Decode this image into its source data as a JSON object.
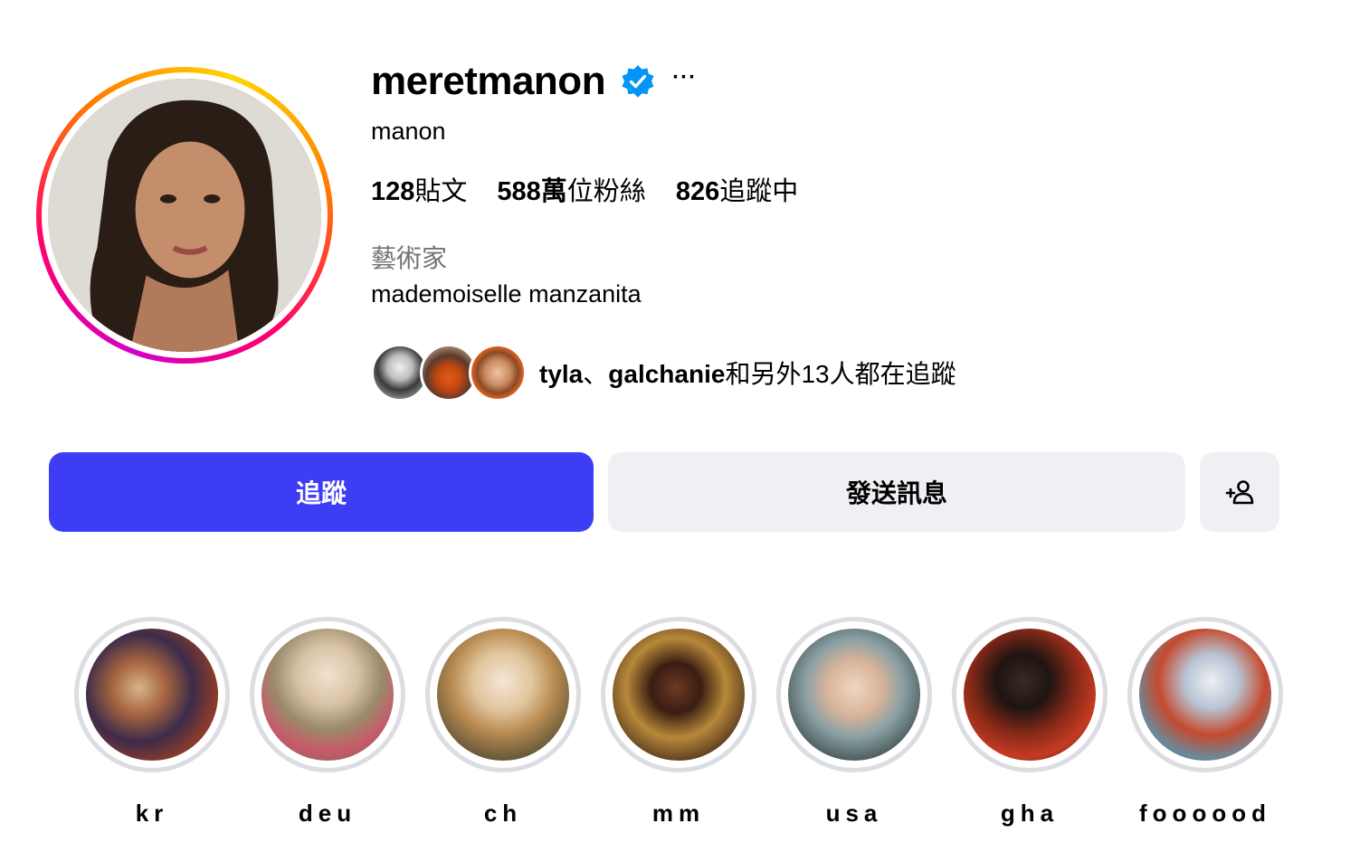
{
  "profile": {
    "username": "meretmanon",
    "full_name": "manon",
    "category": "藝術家",
    "bio": "mademoiselle manzanita",
    "more_label": "···",
    "verified_icon": "verified-badge-icon",
    "verified_color": "#0095f6"
  },
  "stats": {
    "posts_count": "128",
    "posts_label": "貼文",
    "followers_count": "588萬",
    "followers_label": "位粉絲",
    "following_count": "826",
    "following_label": "追蹤中"
  },
  "followed_by": {
    "name1": "tyla",
    "sep": "、",
    "name2": "galchanie",
    "suffix": "和另外13人都在追蹤"
  },
  "buttons": {
    "follow_label": "追蹤",
    "message_label": "發送訊息",
    "suggest_icon": "add-person-icon",
    "follow_color": "#3d3df5"
  },
  "highlights": [
    {
      "label": "kr"
    },
    {
      "label": "deu"
    },
    {
      "label": "ch"
    },
    {
      "label": "mm"
    },
    {
      "label": "usa"
    },
    {
      "label": "gha"
    },
    {
      "label": "foooood"
    }
  ]
}
